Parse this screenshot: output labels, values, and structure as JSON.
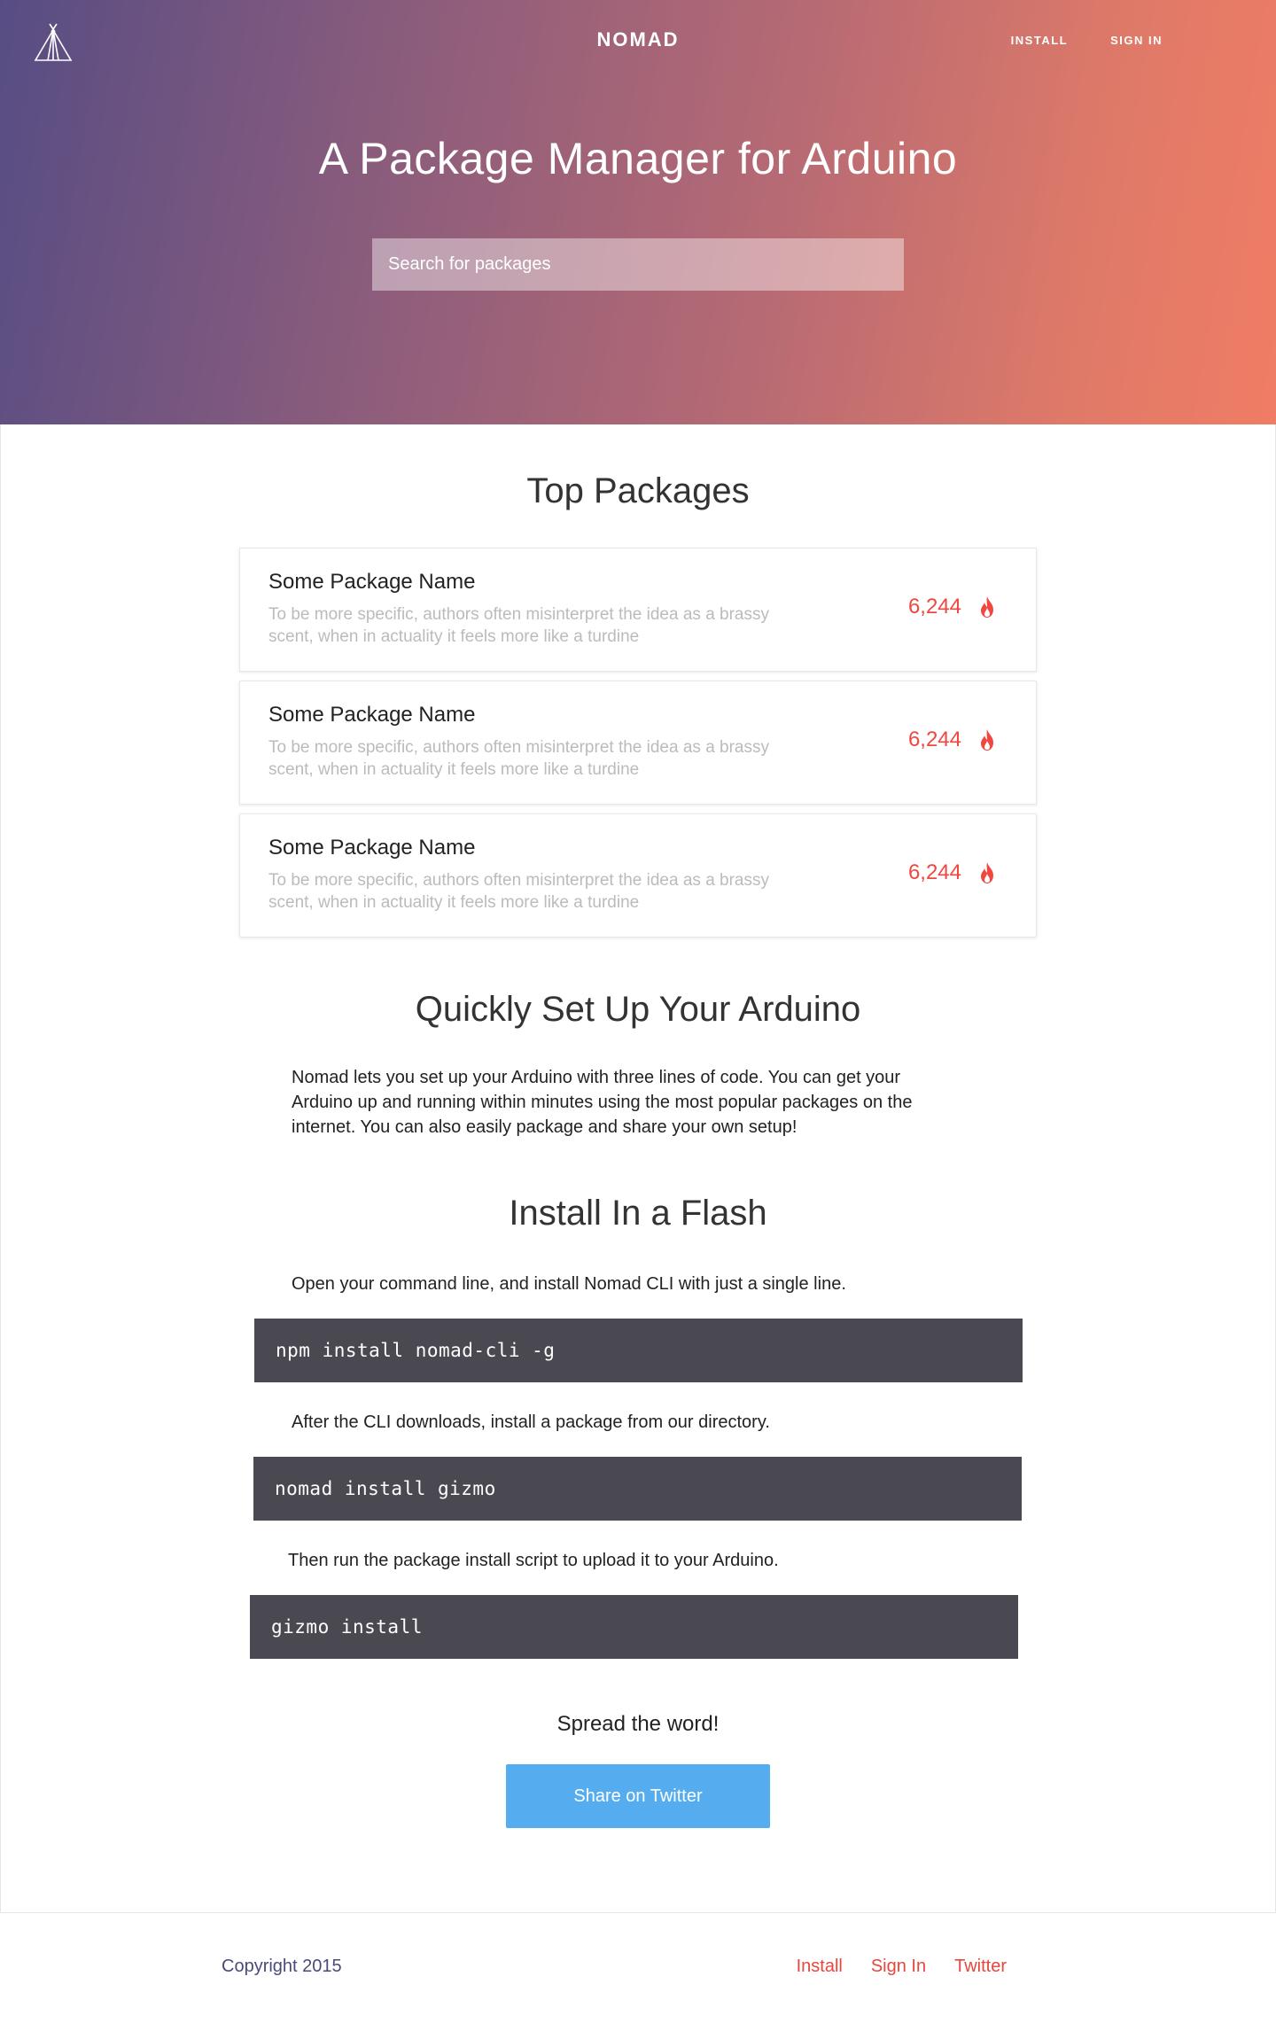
{
  "header": {
    "brand": "NOMAD",
    "nav": {
      "install": "INSTALL",
      "sign_in": "SIGN IN"
    },
    "title": "A Package Manager for Arduino",
    "search_placeholder": "Search for packages"
  },
  "top_packages": {
    "title": "Top Packages",
    "items": [
      {
        "name": "Some Package Name",
        "description": "To be more specific, authors often misinterpret the idea as a brassy scent, when in actuality it feels more like a turdine",
        "count": "6,244",
        "icon": "flame-icon"
      },
      {
        "name": "Some Package Name",
        "description": "To be more specific, authors often misinterpret the idea as a brassy scent, when in actuality it feels more like a turdine",
        "count": "6,244",
        "icon": "flame-icon"
      },
      {
        "name": "Some Package Name",
        "description": "To be more specific, authors often misinterpret the idea as a brassy scent, when in actuality it feels more like a turdine",
        "count": "6,244",
        "icon": "flame-icon"
      }
    ]
  },
  "setup": {
    "title": "Quickly Set Up Your Arduino",
    "body": "Nomad lets you set up your Arduino with three lines of code. You can get your Arduino up and running within minutes using the most popular packages on the internet. You can also easily package and share your own setup!"
  },
  "install": {
    "title": "Install In a Flash",
    "step1": "Open your command line, and install Nomad CLI with just a single line.",
    "code1": "npm install nomad-cli -g",
    "step2": "After the CLI downloads, install a package from our directory.",
    "code2": "nomad install gizmo",
    "step3": "Then run the package install script to upload it to your Arduino.",
    "code3": "gizmo install"
  },
  "share": {
    "label": "Spread the word!",
    "button": "Share on Twitter",
    "button_color": "#55acee"
  },
  "footer": {
    "copyright": "Copyright 2015",
    "links": {
      "install": "Install",
      "sign_in": "Sign In",
      "twitter": "Twitter"
    },
    "link_color": "#e8453c"
  },
  "colors": {
    "gradient_start": "#574d84",
    "gradient_end": "#f07c64",
    "count_color": "#f0473f",
    "code_bg": "#4a4850"
  }
}
